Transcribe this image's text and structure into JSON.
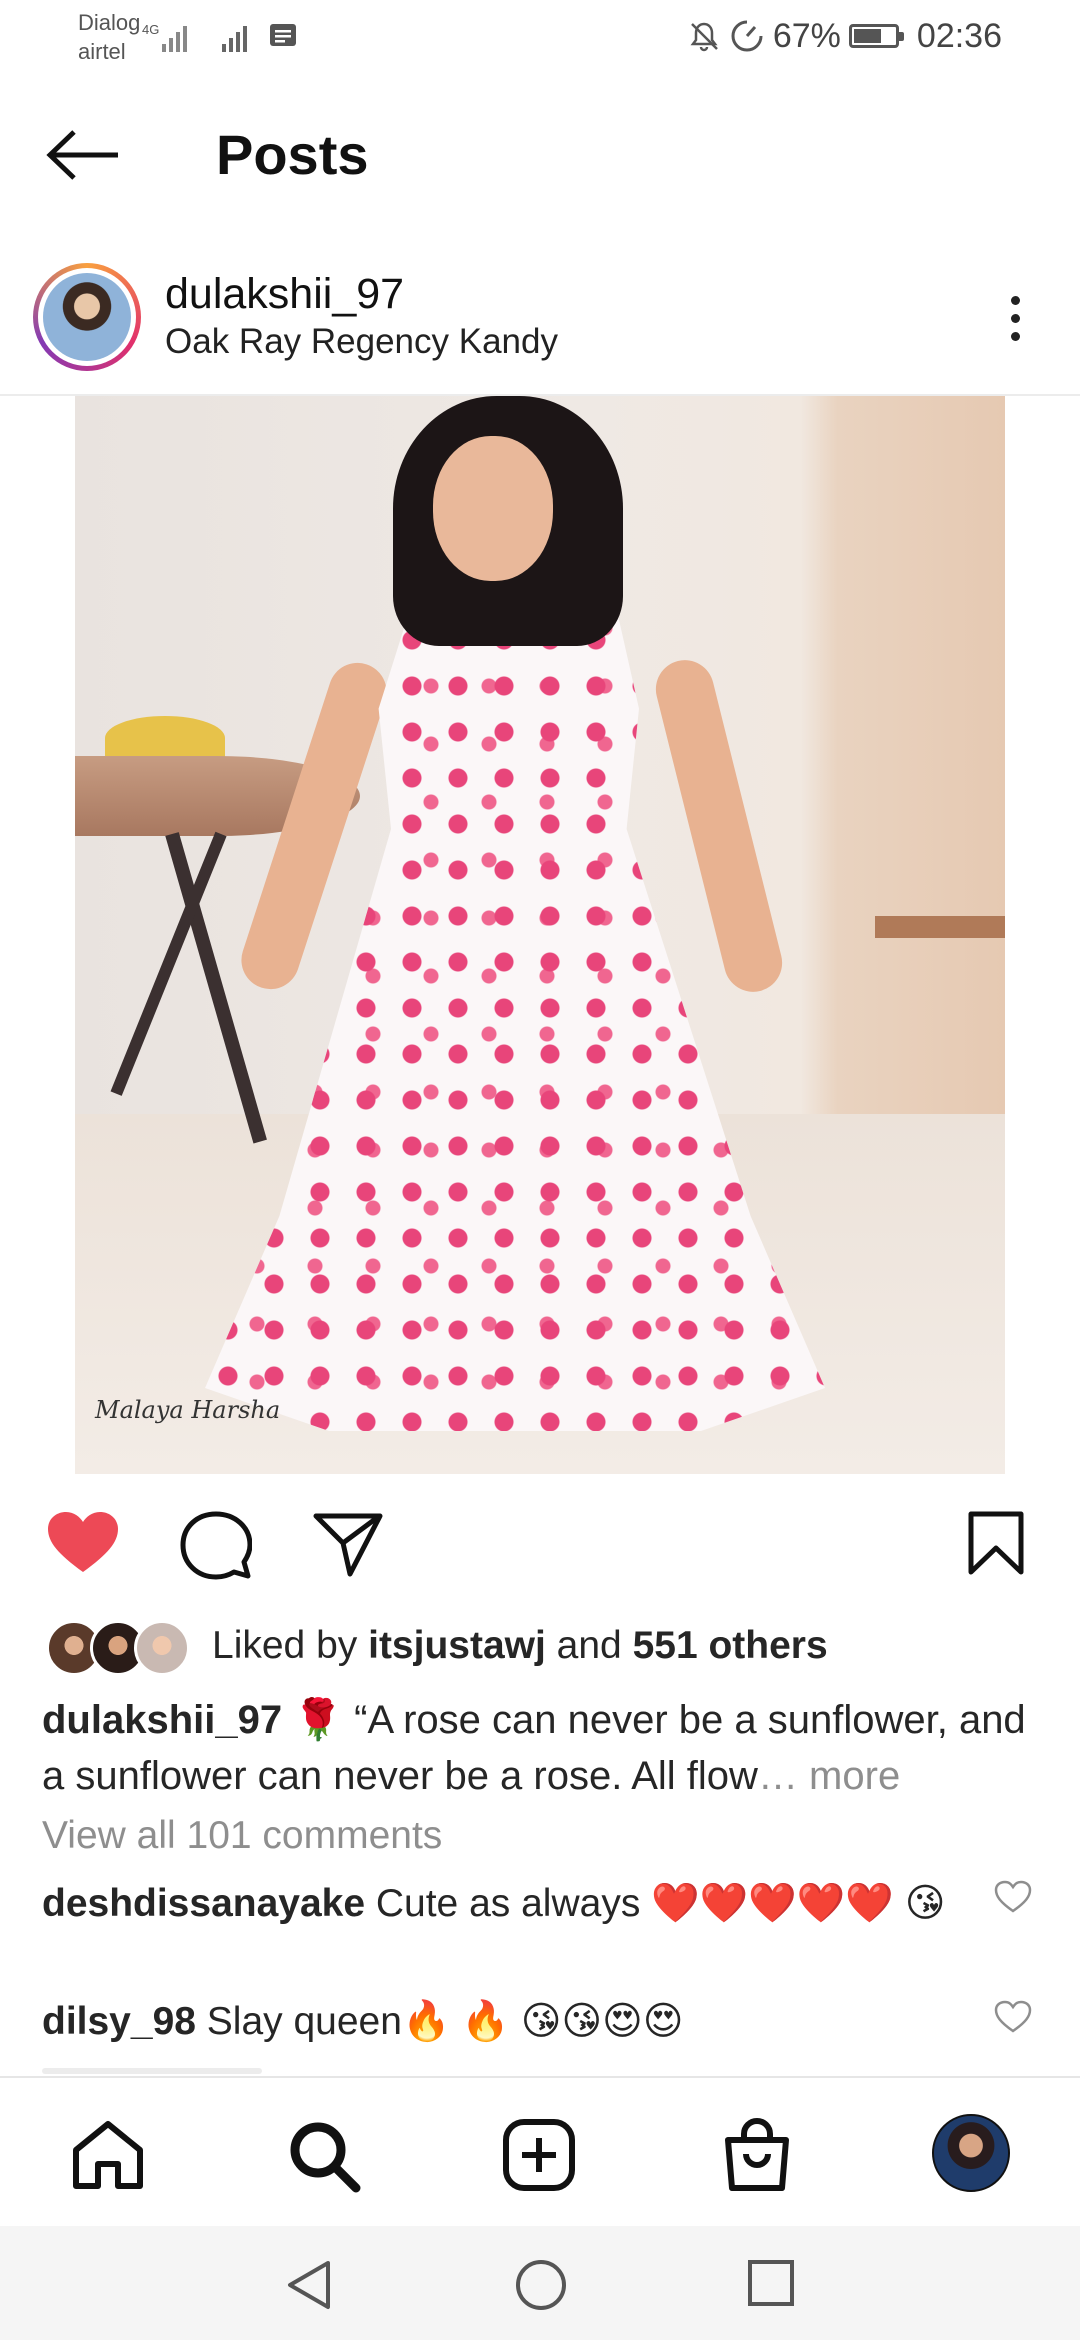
{
  "status_bar": {
    "carrier_line1": "Dialog",
    "carrier_line2": "airtel",
    "network": "4G",
    "battery_percent": "67%",
    "battery_level": 0.67,
    "time": "02:36"
  },
  "header": {
    "title": "Posts"
  },
  "post": {
    "username": "dulakshii_97",
    "location": "Oak Ray Regency Kandy",
    "photo_signature": "Malaya Harsha",
    "liked_prefix": "Liked by ",
    "liked_user": "itsjustawj",
    "liked_and": " and ",
    "liked_others": "551 others",
    "caption_username": "dulakshii_97",
    "caption_text": " 🌹 “A rose can never be a sunflower, and a sunflower can never be a rose. All flow",
    "caption_more": "… more",
    "view_comments": "View all 101 comments",
    "comments": [
      {
        "username": "deshdissanayake",
        "text": " Cute as always ❤️❤️❤️❤️❤️ 😘"
      },
      {
        "username": "dilsy_98",
        "text": " Slay queen🔥 🔥 😘😘😍😍"
      }
    ]
  },
  "colors": {
    "like_red": "#ed4956",
    "text": "#262626",
    "muted": "#8e8e8e"
  }
}
